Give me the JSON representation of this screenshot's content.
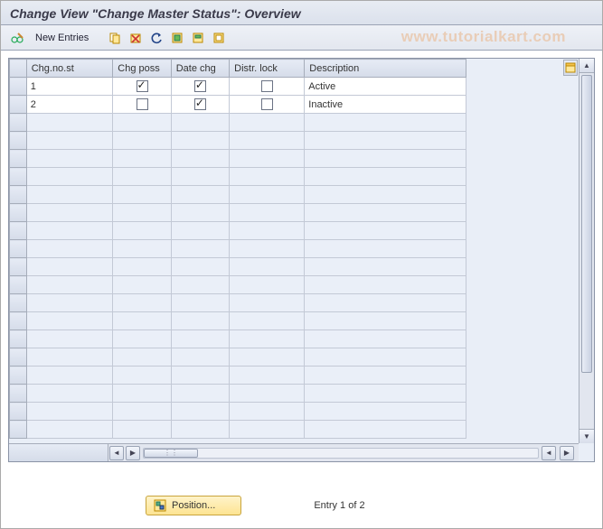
{
  "title": "Change View \"Change Master Status\": Overview",
  "watermark": "www.tutorialkart.com",
  "toolbar": {
    "new_entries": "New Entries"
  },
  "table": {
    "columns": {
      "chg_no_st": "Chg.no.st",
      "chg_poss": "Chg poss",
      "date_chg": "Date chg",
      "distr_lock": "Distr. lock",
      "description": "Description"
    },
    "rows": [
      {
        "st": "1",
        "poss": true,
        "date": true,
        "lock": false,
        "desc": "Active"
      },
      {
        "st": "2",
        "poss": false,
        "date": true,
        "lock": false,
        "desc": "Inactive"
      }
    ]
  },
  "footer": {
    "position_label": "Position...",
    "entry_info": "Entry 1 of 2"
  }
}
